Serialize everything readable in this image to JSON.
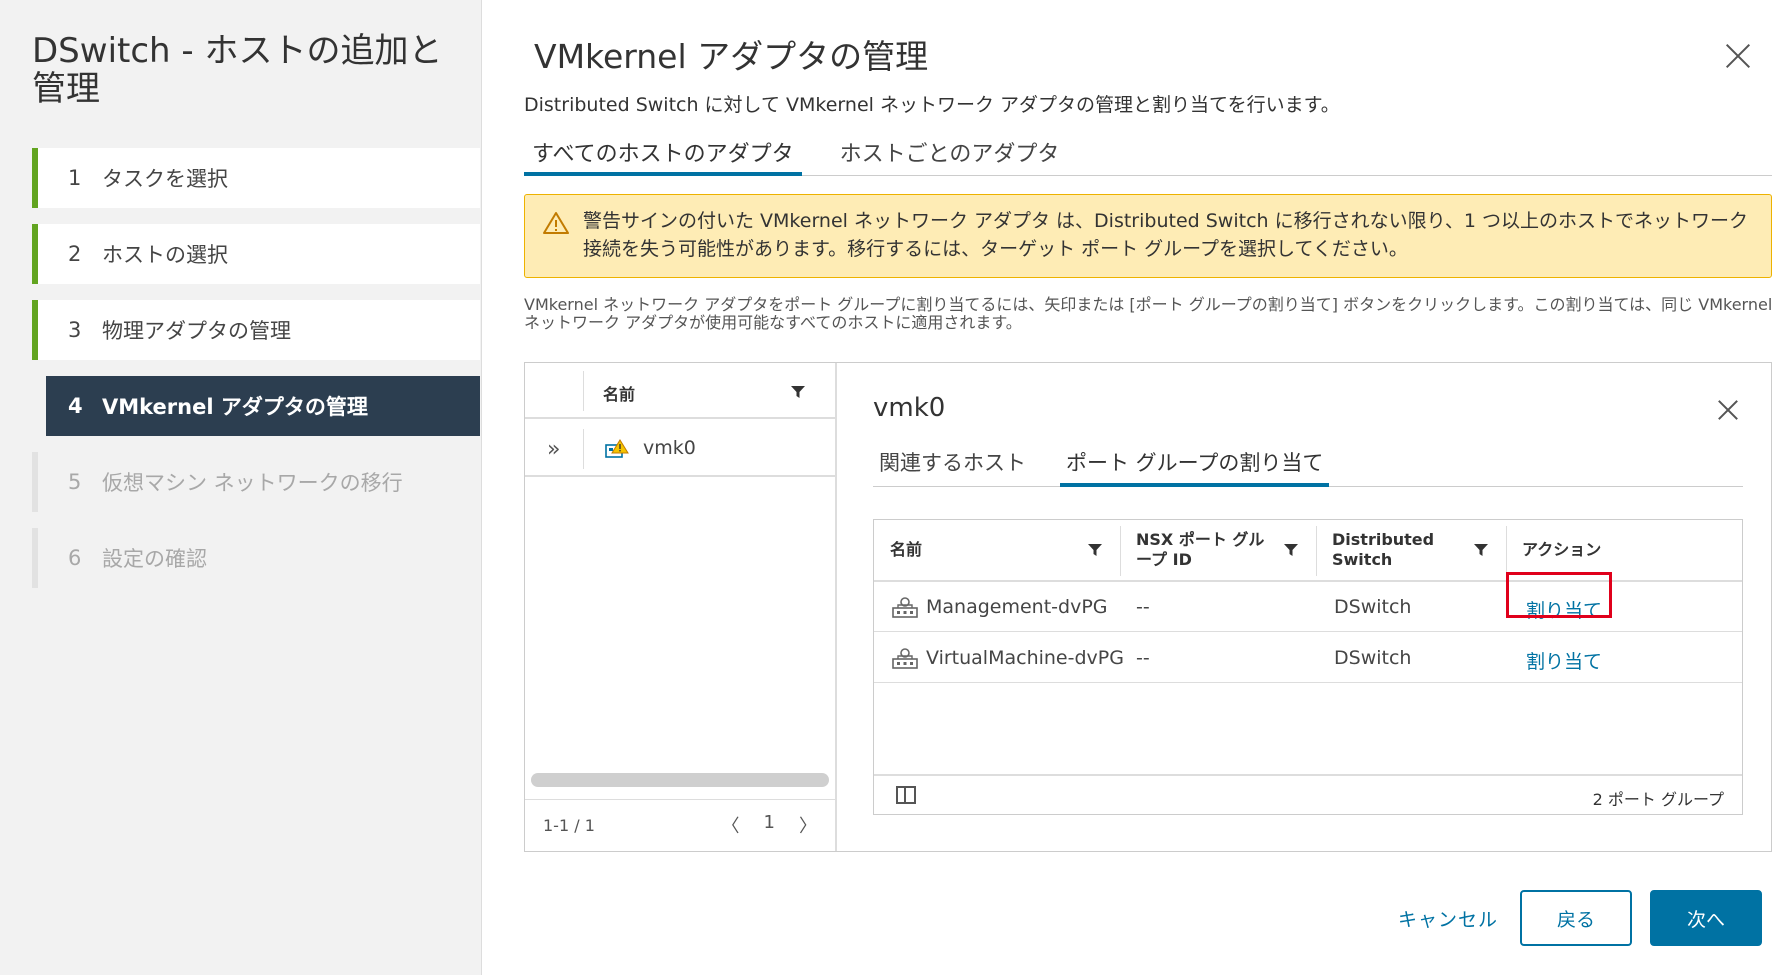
{
  "wizard": {
    "title": "DSwitch - ホストの追加と管理",
    "steps": [
      {
        "num": "1",
        "label": "タスクを選択",
        "state": "done"
      },
      {
        "num": "2",
        "label": "ホストの選択",
        "state": "done"
      },
      {
        "num": "3",
        "label": "物理アダプタの管理",
        "state": "done"
      },
      {
        "num": "4",
        "label": "VMkernel アダプタの管理",
        "state": "active"
      },
      {
        "num": "5",
        "label": "仮想マシン ネットワークの移行",
        "state": "pending"
      },
      {
        "num": "6",
        "label": "設定の確認",
        "state": "pending"
      }
    ]
  },
  "main": {
    "title": "VMkernel アダプタの管理",
    "subtitle": "Distributed Switch に対して VMkernel ネットワーク アダプタの管理と割り当てを行います。",
    "tabs": [
      "すべてのホストのアダプタ",
      "ホストごとのアダプタ"
    ],
    "alert": {
      "icon": "warning-icon",
      "text": "警告サインの付いた VMkernel ネットワーク アダプタ は、Distributed Switch に移行されない限り、1 つ以上のホストでネットワーク接続を失う可能性があります。移行するには、ターゲット ポート グループを選択してください。"
    },
    "info": "VMkernel ネットワーク アダプタをポート グループに割り当てるには、矢印または [ポート グループの割り当て] ボタンをクリックします。この割り当ては、同じ VMkernel ネットワーク アダプタが使用可能なすべてのホストに適用されます。"
  },
  "adapter_grid": {
    "column_name": "名前",
    "rows": [
      {
        "name": "vmk0",
        "icon": "vmkernel-warning-icon",
        "expander": "»"
      }
    ],
    "count": "1-1 / 1",
    "pager": {
      "prev": "〈",
      "page": "1",
      "next": "〉"
    }
  },
  "detail": {
    "title": "vmk0",
    "tabs": [
      "関連するホスト",
      "ポート グループの割り当て"
    ],
    "columns": [
      "名前",
      "NSX ポート グループ ID",
      "Distributed Switch",
      "アクション"
    ],
    "rows": [
      {
        "name": "Management-dvPG",
        "nsx_id": "--",
        "switch": "DSwitch",
        "action": "割り当て"
      },
      {
        "name": "VirtualMachine-dvPG",
        "nsx_id": "--",
        "switch": "DSwitch",
        "action": "割り当て"
      }
    ],
    "total": "2 ポート グループ"
  },
  "footer": {
    "cancel": "キャンセル",
    "back": "戻る",
    "next": "次へ"
  },
  "colors": {
    "accent": "#0072a3",
    "active_step_bg": "#2c3e50",
    "done_bar": "#62a420",
    "alert_bg": "#feecb5",
    "highlight": "#e0001b"
  }
}
